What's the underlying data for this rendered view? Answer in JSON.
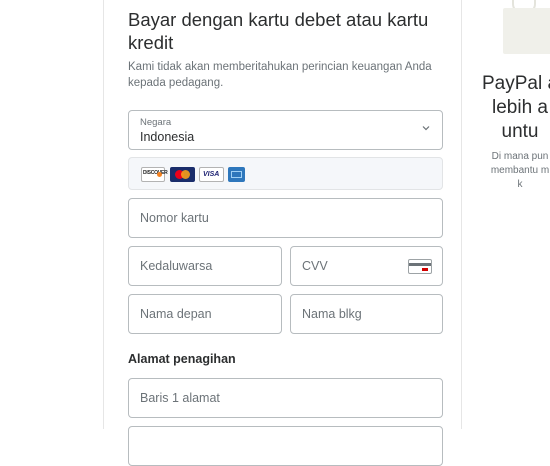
{
  "form": {
    "title": "Bayar dengan kartu debet atau kartu kredit",
    "subtitle": "Kami tidak akan memberitahukan perincian keuangan Anda kepada pedagang.",
    "country": {
      "label": "Negara",
      "value": "Indonesia"
    },
    "accepted_cards": [
      "discover",
      "mastercard",
      "visa",
      "amex"
    ],
    "discover_text": "DISCOVER",
    "visa_text": "VISA",
    "card_number_placeholder": "Nomor kartu",
    "expiry_placeholder": "Kedaluwarsa",
    "cvv_placeholder": "CVV",
    "first_name_placeholder": "Nama depan",
    "last_name_placeholder": "Nama blkg",
    "billing_heading": "Alamat penagihan",
    "address1_placeholder": "Baris 1 alamat"
  },
  "side": {
    "title_lines": [
      "PayPal a",
      "lebih a",
      "untu"
    ],
    "text_lines": [
      "Di mana pun",
      "membantu m",
      "k"
    ]
  },
  "colors": {
    "text": "#2c2e2f",
    "muted": "#6c7378",
    "border": "#b7bcbf"
  }
}
